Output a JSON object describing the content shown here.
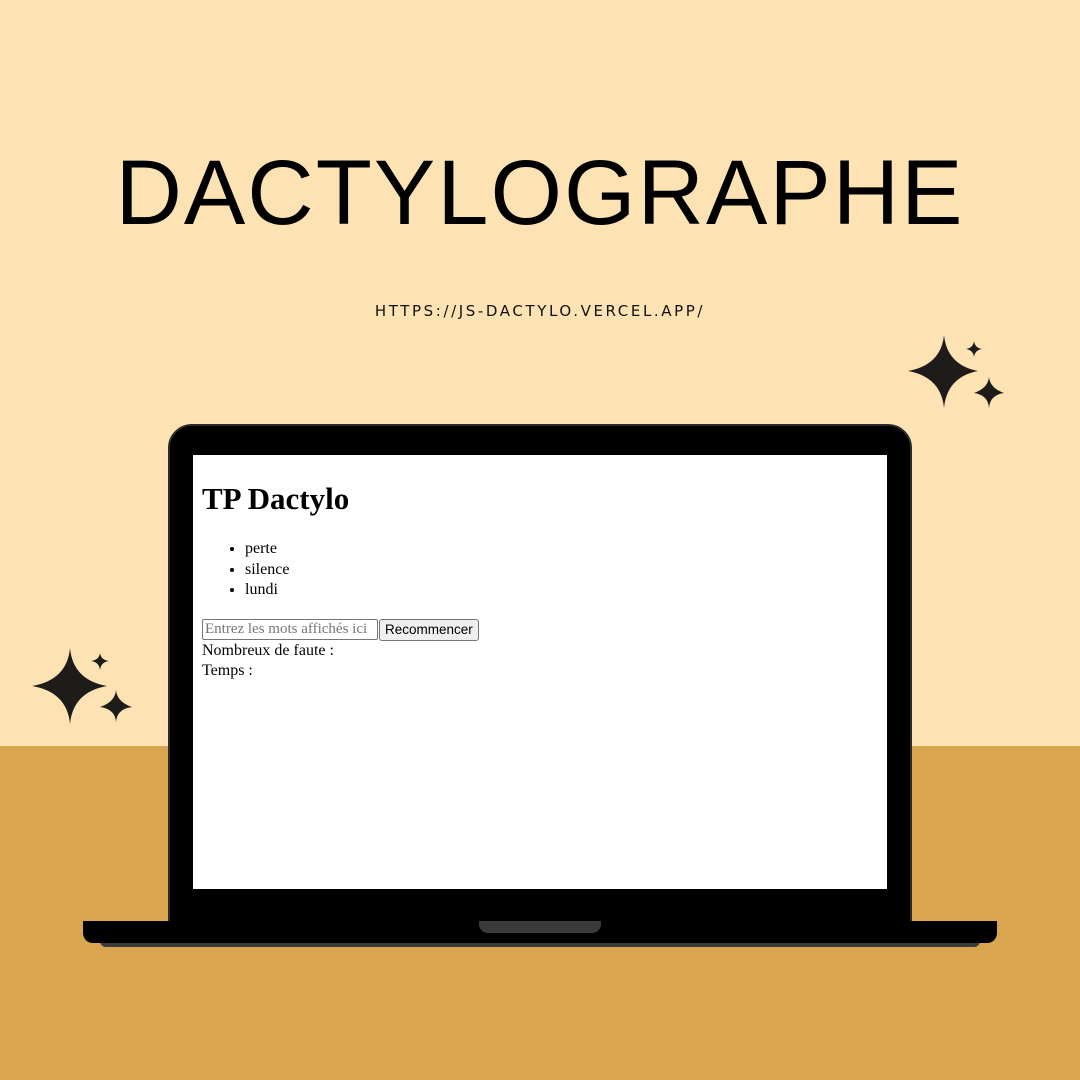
{
  "poster": {
    "title": "DACTYLOGRAPHE",
    "url": "HTTPS://JS-DACTYLO.VERCEL.APP/"
  },
  "app": {
    "heading": "TP Dactylo",
    "words": [
      "perte",
      "silence",
      "lundi"
    ],
    "input_placeholder": "Entrez les mots affichés ici",
    "restart_label": "Recommencer",
    "errors_label": "Nombreux de faute :",
    "time_label": "Temps :"
  },
  "colors": {
    "background": "#fde3b3",
    "floor": "#d9a54f",
    "laptop": "#000000",
    "sparkle": "#1e1b1b"
  },
  "icons": [
    "sparkles-icon",
    "sparkles-icon"
  ]
}
